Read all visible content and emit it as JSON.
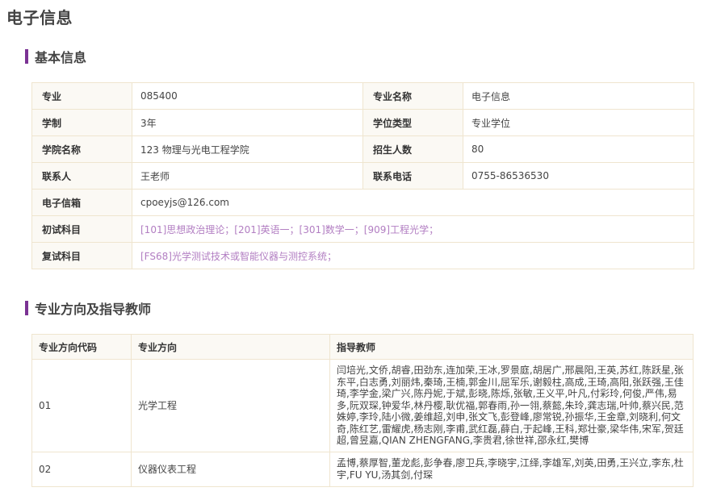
{
  "page": {
    "title": "电子信息"
  },
  "basic_info": {
    "section_title": "基本信息",
    "rows": [
      {
        "label1": "专业",
        "value1": "085400",
        "label2": "专业名称",
        "value2": "电子信息"
      },
      {
        "label1": "学制",
        "value1": "3年",
        "label2": "学位类型",
        "value2": "专业学位"
      },
      {
        "label1": "学院名称",
        "value1": "123 物理与光电工程学院",
        "label2": "招生人数",
        "value2": "80"
      },
      {
        "label1": "联系人",
        "value1": "王老师",
        "label2": "联系电话",
        "value2": "0755-86536530"
      }
    ],
    "email": {
      "label": "电子信箱",
      "value": "cpoeyjs@126.com"
    },
    "initial_exam": {
      "label": "初试科目",
      "value": "[101]思想政治理论；[201]英语一；[301]数学一；[909]工程光学；"
    },
    "retest": {
      "label": "复试科目",
      "value": "[FS68]光学测试技术或智能仪器与测控系统；"
    },
    "colors": {
      "section_bar": "#7b3294",
      "subject_link": "#b27ec2",
      "label_bg": "#fbf9f4",
      "border": "#efe5cf"
    }
  },
  "directions": {
    "section_title": "专业方向及指导教师",
    "headers": {
      "code": "专业方向代码",
      "name": "专业方向",
      "teachers": "指导教师"
    },
    "rows": [
      {
        "code": "01",
        "name": "光学工程",
        "teachers": "闫培光,文侨,胡睿,田劲东,连加荣,王冰,罗景庭,胡居广,邢晨阳,王英,苏红,陈跃星,张东平,白志勇,刘丽炜,秦琦,王楠,郭金川,屈军乐,谢毅柱,高成,王琦,高阳,张跃强,王佳琦,李学金,梁广兴,陈丹妮,于斌,彭晓,陈烁,张敏,王义平,叶凡,付彩玲,何俊,严伟,易多,阮双琛,钟爱华,林丹樱,耿优福,郭春雨,孙一翎,蔡懿,朱玲,龚志瑞,叶帅,蔡兴民,范姝婷,李玲,陆小微,姜维超,刘申,张文飞,彭登峰,廖常锐,孙振华,王金章,刘晓利,何文奇,陈红艺,雷耀虎,杨志刚,李甫,武红磊,薛白,于起峰,王科,郑壮豪,梁华伟,宋军,贺廷超,曾昱嘉,QIAN ZHENGFANG,李贵君,徐世祥,邵永红,樊博"
      },
      {
        "code": "02",
        "name": "仪器仪表工程",
        "teachers": "孟博,蔡厚智,董龙彪,彭争春,廖卫兵,李晓宇,江绎,李雄军,刘英,田勇,王兴立,李东,杜宇,FU YU,汤其剑,付琛"
      }
    ]
  }
}
